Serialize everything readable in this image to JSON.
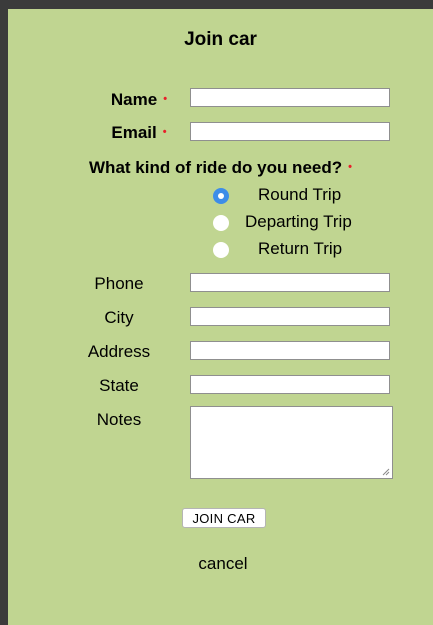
{
  "form": {
    "title": "Join car",
    "name_label": "Name",
    "email_label": "Email",
    "required_marker": "•",
    "ride_question": "What kind of ride do you need?",
    "ride_options": [
      {
        "label": "Round Trip",
        "selected": true
      },
      {
        "label": "Departing Trip",
        "selected": false
      },
      {
        "label": "Return Trip",
        "selected": false
      }
    ],
    "phone_label": "Phone",
    "city_label": "City",
    "address_label": "Address",
    "state_label": "State",
    "notes_label": "Notes",
    "submit_label": "JOIN CAR",
    "cancel_label": "cancel"
  },
  "colors": {
    "background": "#c0d591",
    "required": "#e8202a",
    "radio_selected": "#3d8de8"
  }
}
